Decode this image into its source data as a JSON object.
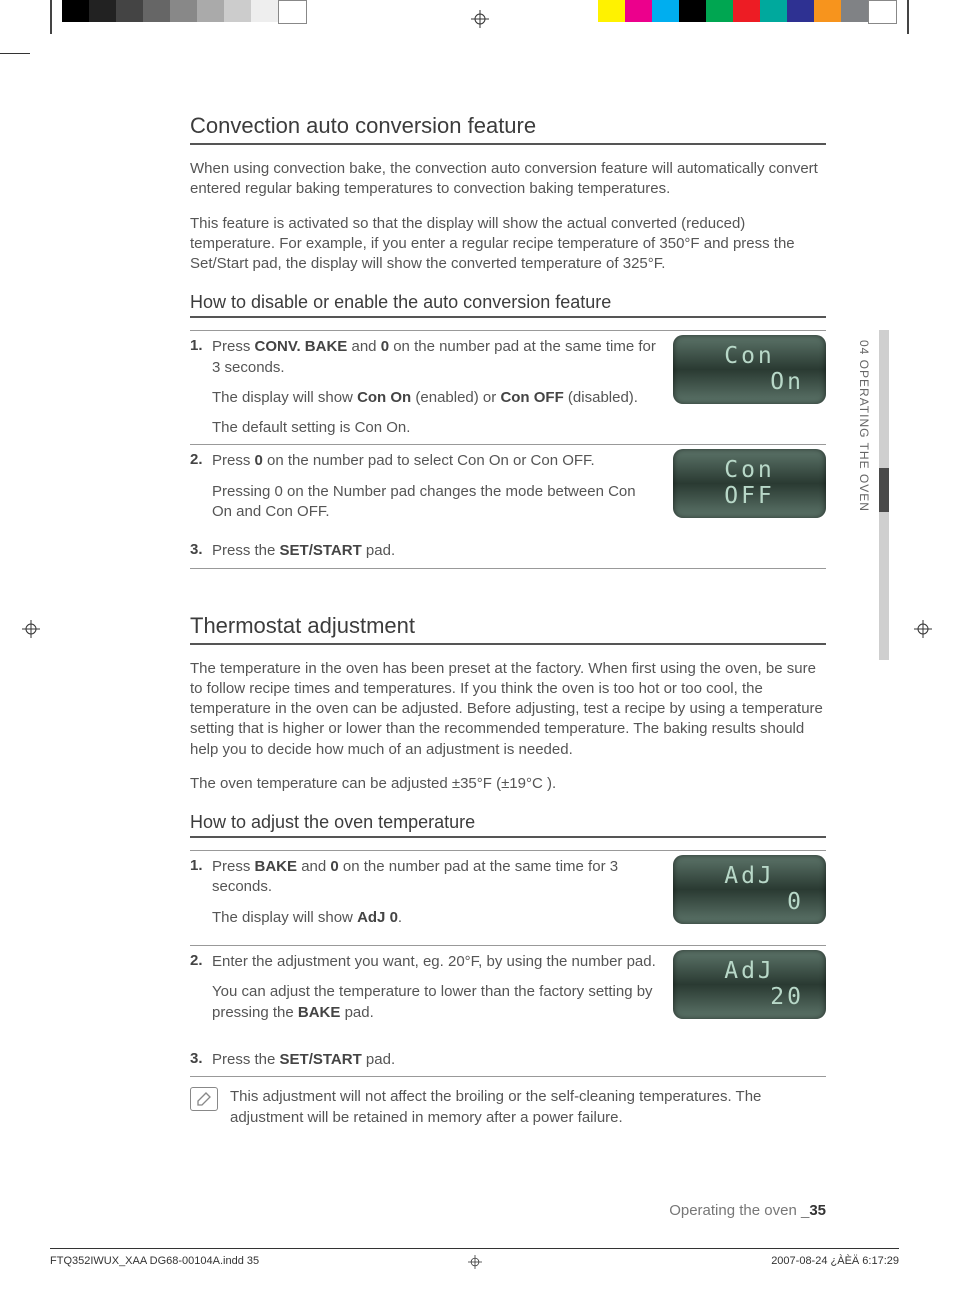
{
  "reg_colors_left": [
    "#000",
    "#222",
    "#444",
    "#666",
    "#888",
    "#aaa",
    "#ccc",
    "#eee",
    "#fff"
  ],
  "reg_colors_right": [
    "#fff200",
    "#ec008c",
    "#00aeef",
    "#000",
    "#00a651",
    "#ed1c24",
    "#00a99d",
    "#2e3192",
    "#f7941d",
    "#808285",
    "#fff"
  ],
  "section1": {
    "title": "Convection auto conversion feature",
    "p1": "When using convection bake, the convection auto conversion feature will automatically convert entered regular baking temperatures to convection baking temperatures.",
    "p2": "This feature is activated so that the display will show the actual converted (reduced) temperature. For example, if you enter a regular recipe temperature of 350°F and press the Set/Start pad, the display will show the converted temperature of 325°F.",
    "sub": "How to disable or enable the auto conversion feature",
    "s1": {
      "n": "1.",
      "a": "Press ",
      "b": "CONV. BAKE",
      "c": " and ",
      "d": "0",
      "e": " on the number pad at the same time for 3 seconds.",
      "f": "The display will show ",
      "g": "Con On",
      "h": " (enabled) or ",
      "i": "Con OFF",
      "j": " (disabled).",
      "k": "The default setting is Con On.",
      "disp1": "Con",
      "disp2": "On"
    },
    "s2": {
      "n": "2.",
      "a": "Press ",
      "b": "0",
      "c": " on the number pad to select Con On or Con OFF.",
      "d": "Pressing 0 on the Number pad changes the mode between Con On and Con OFF.",
      "disp1": "Con",
      "disp2": "OFF"
    },
    "s3": {
      "n": "3.",
      "a": "Press the ",
      "b": "SET/START",
      "c": " pad."
    }
  },
  "section2": {
    "title": "Thermostat adjustment",
    "p1": "The temperature in the oven has been preset at the factory. When first using the oven, be sure to follow recipe times and temperatures. If you think the oven is too hot or too cool, the temperature in the oven can be adjusted. Before adjusting, test a recipe by using a temperature setting that is higher or lower than the recommended temperature. The baking results should help you to decide how much of an adjustment is needed.",
    "p2": "The oven temperature can be adjusted ±35°F (±19°C ).",
    "sub": "How to adjust the oven temperature",
    "s1": {
      "n": "1.",
      "a": "Press ",
      "b": "BAKE",
      "c": " and ",
      "d": "0",
      "e": " on the number pad at the same time for 3 seconds.",
      "f": "The display will show ",
      "g": "AdJ 0",
      "h": ".",
      "disp1": "AdJ",
      "disp2": "0"
    },
    "s2": {
      "n": "2.",
      "a": "Enter the adjustment you want, eg. 20°F, by using the number pad.",
      "b": "You can adjust the temperature to lower than the factory setting by pressing the ",
      "c": "BAKE",
      "d": " pad.",
      "disp1": "AdJ",
      "disp2": "20"
    },
    "s3": {
      "n": "3.",
      "a": "Press the ",
      "b": "SET/START",
      "c": " pad."
    },
    "note": "This adjustment will not affect the broiling or the self-cleaning temperatures. The adjustment will be retained in memory after a power failure."
  },
  "side": "04  OPERATING THE OVEN",
  "footer": {
    "a": "Operating the oven _",
    "b": "35"
  },
  "printfoot": {
    "l": "FTQ352IWUX_XAA DG68-00104A.indd   35",
    "r": "2007-08-24   ¿ÀÈÄ 6:17:29"
  }
}
